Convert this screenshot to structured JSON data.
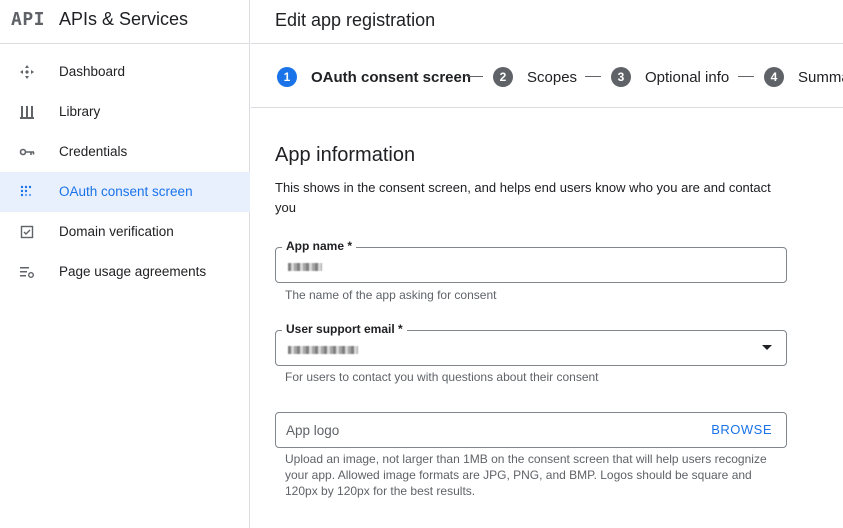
{
  "brand": {
    "logo": "API",
    "title": "APIs & Services"
  },
  "sidebar": {
    "items": [
      {
        "label": "Dashboard",
        "icon": "dashboard-icon",
        "active": false
      },
      {
        "label": "Library",
        "icon": "library-icon",
        "active": false
      },
      {
        "label": "Credentials",
        "icon": "key-icon",
        "active": false
      },
      {
        "label": "OAuth consent screen",
        "icon": "consent-icon",
        "active": true
      },
      {
        "label": "Domain verification",
        "icon": "checkbox-icon",
        "active": false
      },
      {
        "label": "Page usage agreements",
        "icon": "settings-list-icon",
        "active": false
      }
    ]
  },
  "header": {
    "title": "Edit app registration"
  },
  "stepper": {
    "steps": [
      {
        "num": "1",
        "label": "OAuth consent screen",
        "active": true
      },
      {
        "num": "2",
        "label": "Scopes",
        "active": false
      },
      {
        "num": "3",
        "label": "Optional info",
        "active": false
      },
      {
        "num": "4",
        "label": "Summa",
        "active": false
      }
    ]
  },
  "main": {
    "title": "App information",
    "description": "This shows in the consent screen, and helps end users know who you are and contact you",
    "app_name": {
      "label": "App name *",
      "helper": "The name of the app asking for consent"
    },
    "support_email": {
      "label": "User support email *",
      "helper": "For users to contact you with questions about their consent"
    },
    "app_logo": {
      "placeholder": "App logo",
      "browse_label": "BROWSE",
      "helper": "Upload an image, not larger than 1MB on the consent screen that will help users recognize your app. Allowed image formats are JPG, PNG, and BMP. Logos should be square and 120px by 120px for the best results."
    }
  },
  "colors": {
    "accent": "#1a73e8",
    "active_bg": "#e8f0fe",
    "border": "#dadce0",
    "muted": "#5f6368"
  }
}
